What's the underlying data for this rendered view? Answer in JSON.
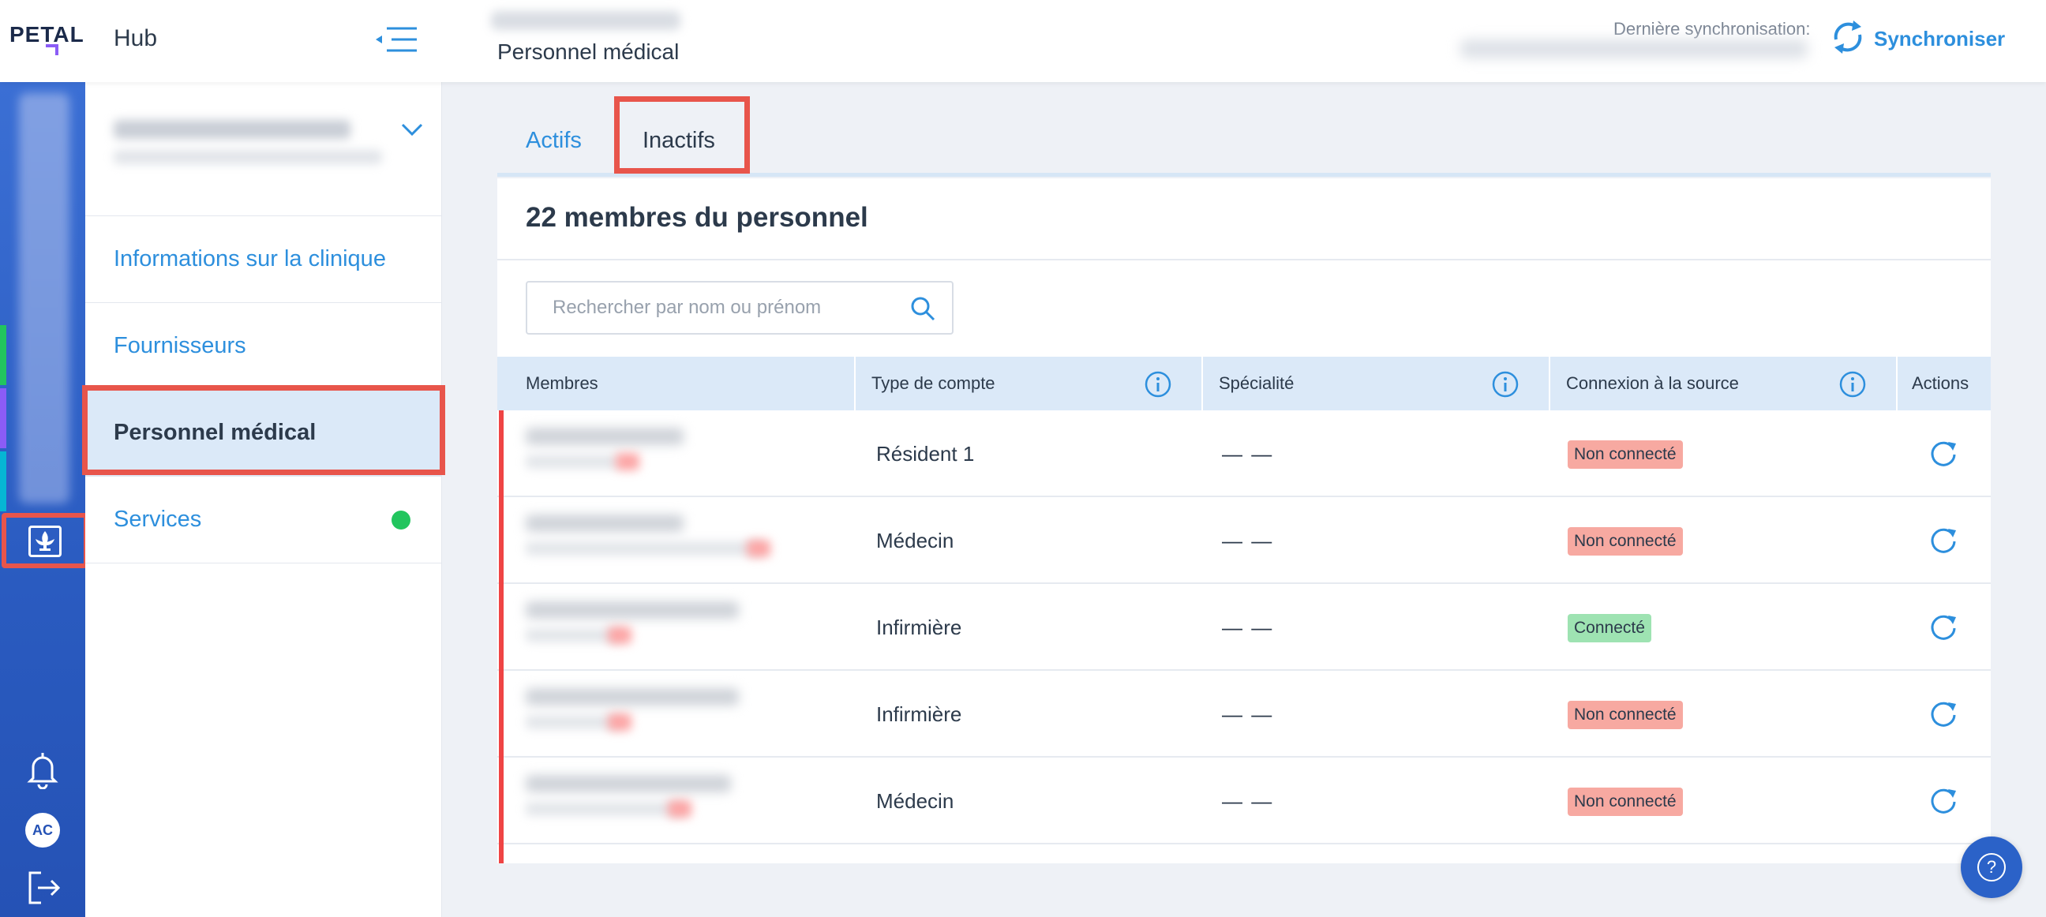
{
  "header": {
    "logo_text": "PETAL",
    "hub_title": "Hub",
    "page_title": "Personnel médical",
    "sync_label": "Dernière synchronisation:",
    "sync_button": "Synchroniser"
  },
  "rail": {
    "avatar_initials": "AC",
    "icons": [
      "clinic-icon",
      "bell-icon",
      "logout-icon"
    ],
    "accent_colors": [
      "#22c55e",
      "#8b5cf6",
      "#06b6d4"
    ]
  },
  "sidenav": {
    "items": [
      {
        "label": "Informations sur la clinique",
        "active": false
      },
      {
        "label": "Fournisseurs",
        "active": false
      },
      {
        "label": "Personnel médical",
        "active": true
      },
      {
        "label": "Services",
        "active": false,
        "status": "green-dot"
      }
    ]
  },
  "tabs": [
    {
      "label": "Actifs",
      "selected": false
    },
    {
      "label": "Inactifs",
      "selected": true
    }
  ],
  "card": {
    "title": "22 membres du personnel",
    "search_placeholder": "Rechercher par nom ou prénom"
  },
  "table": {
    "columns": [
      "Membres",
      "Type de compte",
      "Spécialité",
      "Connexion à la source",
      "Actions"
    ],
    "rows": [
      {
        "type": "Résident 1",
        "speciality": "— —",
        "status": "Non connecté",
        "connected": false
      },
      {
        "type": "Médecin",
        "speciality": "— —",
        "status": "Non connecté",
        "connected": false
      },
      {
        "type": "Infirmière",
        "speciality": "— —",
        "status": "Connecté",
        "connected": true
      },
      {
        "type": "Infirmière",
        "speciality": "— —",
        "status": "Non connecté",
        "connected": false
      },
      {
        "type": "Médecin",
        "speciality": "— —",
        "status": "Non connecté",
        "connected": false
      }
    ]
  },
  "help": {
    "label": "?"
  },
  "colors": {
    "accent": "#2d8fdd",
    "highlight_frame": "#e8554b",
    "rail": "#2a5bc0",
    "connected": "#9ee3b2",
    "not_connected": "#f7a9a1",
    "inactive_bar": "#ef4444"
  }
}
